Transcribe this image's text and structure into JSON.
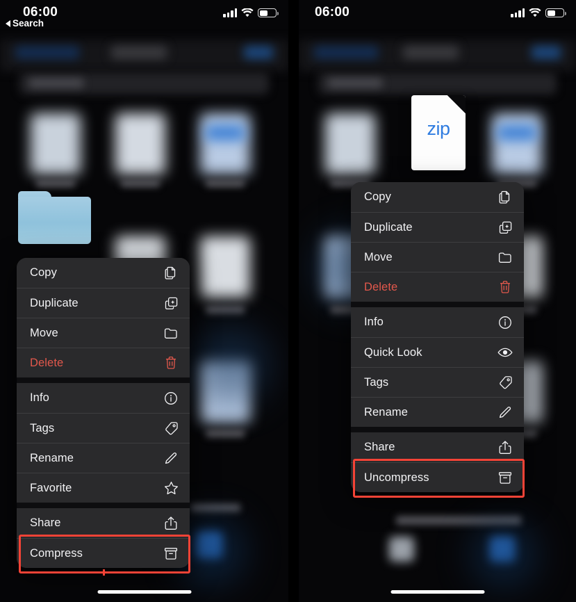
{
  "left_panel": {
    "status_bar": {
      "time": "06:00",
      "back_label": "Search",
      "icons": [
        "cellular-signal-icon",
        "wifi-icon",
        "battery-icon"
      ]
    },
    "selected_item": {
      "type": "folder",
      "icon": "folder-icon"
    },
    "context_menu": {
      "groups": [
        {
          "items": [
            {
              "label": "Copy",
              "icon": "copy-icon",
              "destructive": false
            },
            {
              "label": "Duplicate",
              "icon": "duplicate-icon",
              "destructive": false
            },
            {
              "label": "Move",
              "icon": "folder-icon",
              "destructive": false
            },
            {
              "label": "Delete",
              "icon": "trash-icon",
              "destructive": true
            }
          ]
        },
        {
          "items": [
            {
              "label": "Info",
              "icon": "info-circle-icon",
              "destructive": false
            },
            {
              "label": "Tags",
              "icon": "tag-icon",
              "destructive": false
            },
            {
              "label": "Rename",
              "icon": "pencil-icon",
              "destructive": false
            },
            {
              "label": "Favorite",
              "icon": "star-icon",
              "destructive": false
            }
          ]
        },
        {
          "items": [
            {
              "label": "Share",
              "icon": "share-icon",
              "destructive": false
            },
            {
              "label": "Compress",
              "icon": "archive-box-icon",
              "destructive": false
            }
          ]
        }
      ]
    },
    "highlight": {
      "target_label": "Compress",
      "color": "#f44336"
    }
  },
  "right_panel": {
    "status_bar": {
      "time": "06:00",
      "icons": [
        "cellular-signal-icon",
        "wifi-icon",
        "battery-icon"
      ]
    },
    "selected_item": {
      "type": "zip-file",
      "icon": "zip-document-icon",
      "badge_text": "zip"
    },
    "context_menu": {
      "groups": [
        {
          "items": [
            {
              "label": "Copy",
              "icon": "copy-icon",
              "destructive": false
            },
            {
              "label": "Duplicate",
              "icon": "duplicate-icon",
              "destructive": false
            },
            {
              "label": "Move",
              "icon": "folder-icon",
              "destructive": false
            },
            {
              "label": "Delete",
              "icon": "trash-icon",
              "destructive": true
            }
          ]
        },
        {
          "items": [
            {
              "label": "Info",
              "icon": "info-circle-icon",
              "destructive": false
            },
            {
              "label": "Quick Look",
              "icon": "eye-icon",
              "destructive": false
            },
            {
              "label": "Tags",
              "icon": "tag-icon",
              "destructive": false
            },
            {
              "label": "Rename",
              "icon": "pencil-icon",
              "destructive": false
            }
          ]
        },
        {
          "items": [
            {
              "label": "Share",
              "icon": "share-icon",
              "destructive": false
            },
            {
              "label": "Uncompress",
              "icon": "archive-box-icon",
              "destructive": false
            }
          ]
        }
      ]
    },
    "highlight": {
      "target_label": "Uncompress",
      "color": "#f44336"
    }
  },
  "colors": {
    "menu_background": "#2a2a2c",
    "destructive": "#e2584c",
    "highlight": "#f44336",
    "folder": "#9cc8e0",
    "zip_text": "#2f7ce0"
  }
}
